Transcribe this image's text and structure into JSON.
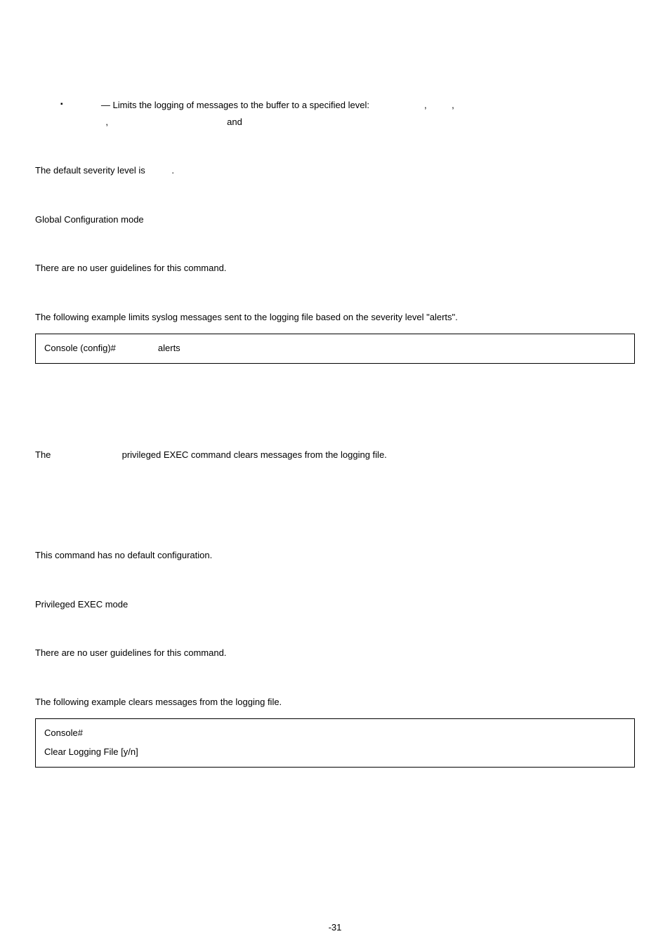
{
  "bullet": {
    "marker": "▪",
    "text_pre": "— Limits the logging of messages to the buffer to a specified level:",
    "sep1": ",",
    "sep2": ",",
    "line2_sep": ",",
    "line2_join": "and"
  },
  "default_severity": {
    "prefix": "The default severity level is",
    "suffix": "."
  },
  "mode1": "Global Configuration mode",
  "guidelines1": "There are no user guidelines for this command.",
  "example1_intro": "The following example limits syslog messages sent to the logging file based on the severity level \"alerts\".",
  "example1_code": {
    "prompt": "Console (config)#",
    "arg": "alerts"
  },
  "clear_desc": {
    "prefix": "The",
    "suffix": "privileged EXEC command clears messages from the logging file."
  },
  "default2": "This command has no default configuration.",
  "mode2": "Privileged EXEC mode",
  "guidelines2": "There are no user guidelines for this command.",
  "example2_intro": "The following example clears messages from the logging file.",
  "example2_code": {
    "line1": "Console#",
    "line2": "Clear Logging File [y/n]"
  },
  "page_number": "-31"
}
